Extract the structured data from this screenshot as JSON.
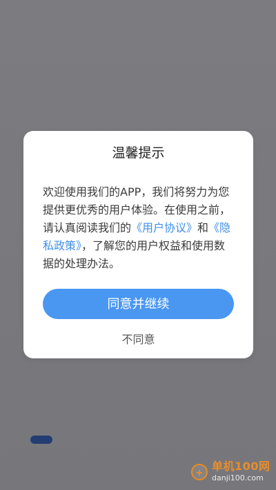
{
  "dialog": {
    "title": "温馨提示",
    "body_intro": "欢迎使用我们的APP，我们将努力为您提供更优秀的用户体验。在使用之前，请认真阅读我们的",
    "user_agreement_link": "《用户协议》",
    "conjunction": "和",
    "privacy_policy_link": "《隐私政策》",
    "body_outro": "，了解您的用户权益和使用数据的处理办法。",
    "agree_button": "同意并继续",
    "disagree_button": "不同意"
  },
  "watermark": {
    "title": "单机100网",
    "url": "danji100.com"
  },
  "colors": {
    "overlay": "#7b7b7f",
    "primary": "#4a97f2",
    "link": "#3f8ee8",
    "text": "#3a3a3a",
    "watermark": "#e88d2b",
    "background_pill": "#1f3a73"
  }
}
